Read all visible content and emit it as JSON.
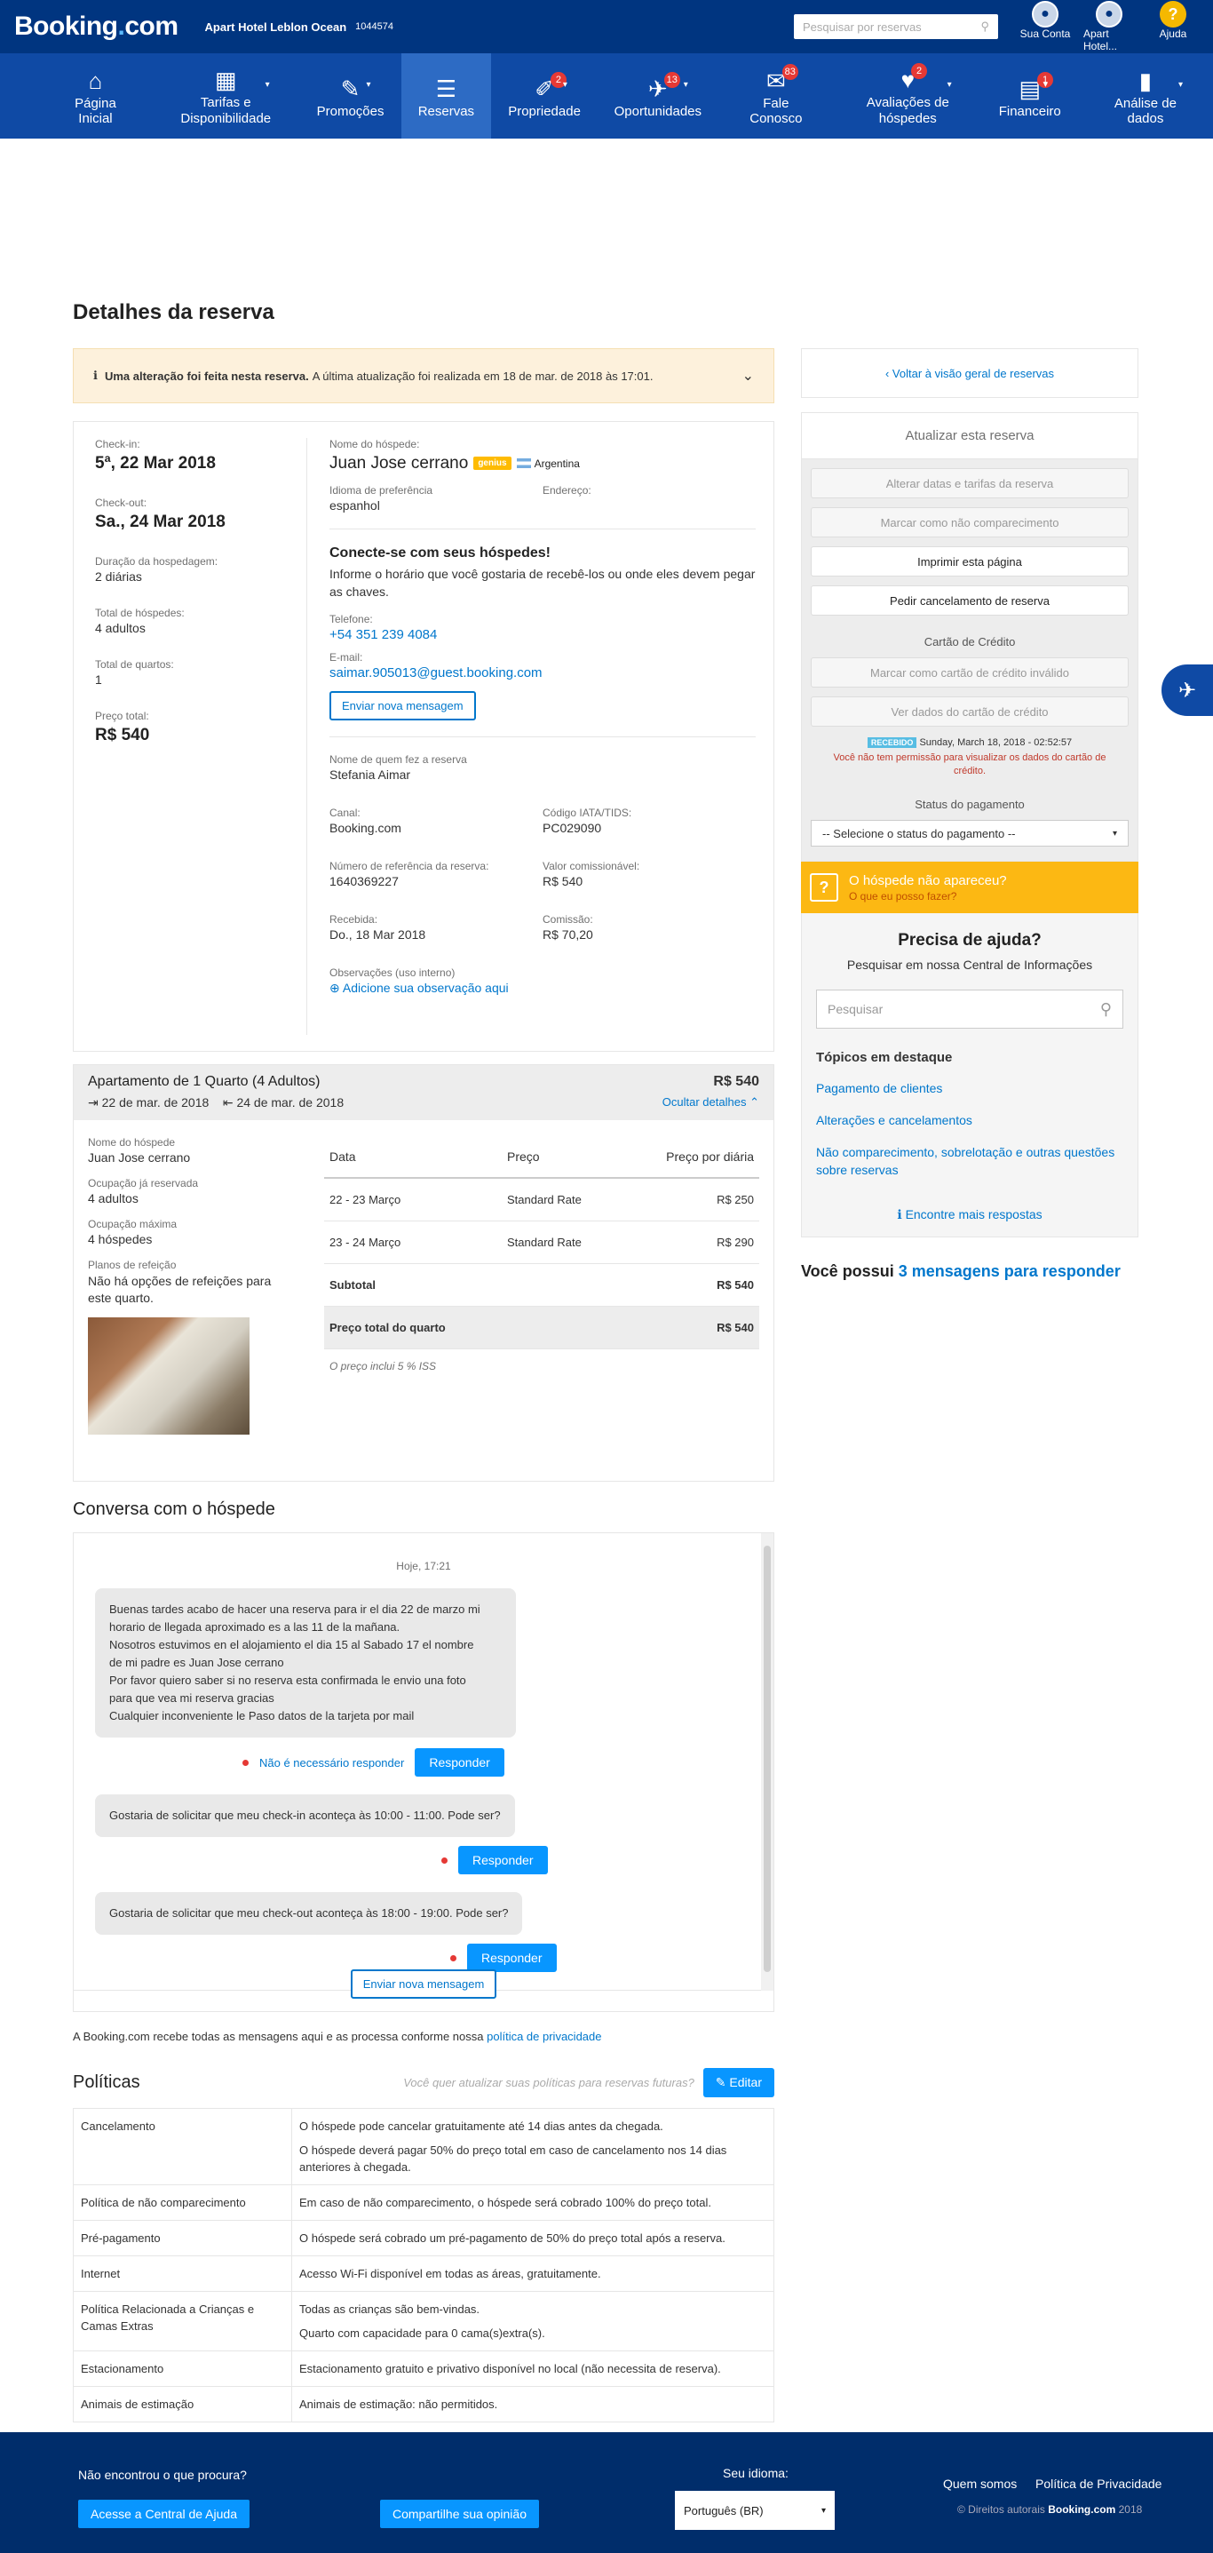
{
  "topbar": {
    "logo_main": "Booking",
    "logo_dot": ".",
    "logo_tld": "com",
    "hotel_name": "Apart Hotel Leblon Ocean",
    "hotel_id": "1044574",
    "search_placeholder": "Pesquisar por reservas",
    "account_label": "Sua Conta",
    "hotel_label": "Apart Hotel...",
    "help_label": "Ajuda",
    "help_glyph": "?"
  },
  "nav": {
    "items": [
      {
        "label": "Página Inicial",
        "icon": "home-icon",
        "glyph": "⌂",
        "badge": ""
      },
      {
        "label": "Tarifas e Disponibilidade",
        "icon": "calendar-icon",
        "glyph": "▦",
        "badge": ""
      },
      {
        "label": "Promoções",
        "icon": "tag-icon",
        "glyph": "✎",
        "badge": ""
      },
      {
        "label": "Reservas",
        "icon": "list-icon",
        "glyph": "☰",
        "badge": ""
      },
      {
        "label": "Propriedade",
        "icon": "pencil-icon",
        "glyph": "✐",
        "badge": "2"
      },
      {
        "label": "Oportunidades",
        "icon": "rocket-icon",
        "glyph": "✈",
        "badge": "13"
      },
      {
        "label": "Fale Conosco",
        "icon": "mail-icon",
        "glyph": "✉",
        "badge": "83"
      },
      {
        "label": "Avaliações de hóspedes",
        "icon": "heart-icon",
        "glyph": "♥",
        "badge": "2"
      },
      {
        "label": "Financeiro",
        "icon": "document-icon",
        "glyph": "▤",
        "badge": "1"
      },
      {
        "label": "Análise de dados",
        "icon": "chart-icon",
        "glyph": "▮",
        "badge": ""
      }
    ],
    "caret": "▾"
  },
  "page": {
    "title": "Detalhes da reserva"
  },
  "alert": {
    "icon": "info-icon",
    "glyph": "ℹ",
    "bold": "Uma alteração foi feita nesta reserva.",
    "text": "A última atualização foi realizada em 18 de mar. de 2018 às 17:01.",
    "chevron": "⌄"
  },
  "booking": {
    "checkin_label": "Check-in:",
    "checkin": "5ª, 22 Mar 2018",
    "checkout_label": "Check-out:",
    "checkout": "Sa., 24 Mar 2018",
    "duration_label": "Duração da hospedagem:",
    "duration": "2 diárias",
    "guests_label": "Total de hóspedes:",
    "guests": "4 adultos",
    "rooms_label": "Total de quartos:",
    "rooms": "1",
    "price_label": "Preço total:",
    "price": "R$ 540",
    "guest_label": "Nome do hóspede:",
    "guest_name": "Juan Jose cerrano",
    "genius": "genius",
    "country": "Argentina",
    "lang_label": "Idioma de preferência",
    "lang": "espanhol",
    "address_label": "Endereço:",
    "connect_title": "Conecte-se com seus hóspedes!",
    "connect_text": "Informe o horário que você gostaria de recebê-los ou onde eles devem pegar as chaves.",
    "phone_label": "Telefone:",
    "phone": "+54 351 239 4084",
    "email_label": "E-mail:",
    "email": "saimar.905013@guest.booking.com",
    "send_msg": "Enviar nova mensagem",
    "booker_label": "Nome de quem fez a reserva",
    "booker": "Stefania Aimar",
    "channel_label": "Canal:",
    "channel": "Booking.com",
    "iata_label": "Código IATA/TIDS:",
    "iata": "PC029090",
    "ref_label": "Número de referência da reserva:",
    "ref": "1640369227",
    "comm_value_label": "Valor comissionável:",
    "comm_value": "R$ 540",
    "received_label": "Recebida:",
    "received": "Do., 18 Mar 2018",
    "commission_label": "Comissão:",
    "commission": "R$ 70,20",
    "notes_label": "Observações (uso interno)",
    "add_note": "Adicione sua observação aqui",
    "add_glyph": "⊕"
  },
  "room": {
    "title": "Apartamento de 1 Quarto (4 Adultos)",
    "checkin": "22 de mar. de 2018",
    "checkout": "24 de mar. de 2018",
    "in_glyph": "⇥",
    "out_glyph": "⇤",
    "price": "R$ 540",
    "hide": "Ocultar detalhes",
    "hide_glyph": "⌃",
    "guest_label": "Nome do hóspede",
    "guest": "Juan Jose cerrano",
    "occ_label": "Ocupação já reservada",
    "occ": "4 adultos",
    "max_label": "Ocupação máxima",
    "max": "4 hóspedes",
    "meal_label": "Planos de refeição",
    "meal": "Não há opções de refeições para este quarto.",
    "table_head": {
      "date": "Data",
      "price": "Preço",
      "per_night": "Preço por diária"
    },
    "rows": [
      {
        "date": "22 - 23 Março",
        "price": "Standard Rate",
        "value": "R$ 250"
      },
      {
        "date": "23 - 24 Março",
        "price": "Standard Rate",
        "value": "R$ 290"
      }
    ],
    "subtotal_label": "Subtotal",
    "subtotal": "R$ 540",
    "total_label": "Preço total do quarto",
    "total": "R$ 540",
    "tax_note": "O preço inclui 5 % ISS"
  },
  "conversation": {
    "title": "Conversa com o hóspede",
    "date": "Hoje, 17:21",
    "msg1": "Buenas tardes acabo de hacer una reserva para ir el dia 22 de marzo mi\nhorario de llegada aproximado es a las 11 de la mañana.\nNosotros estuvimos en el alojamiento el dia 15 al Sabado 17 el nombre\nde mi padre es Juan Jose cerrano\nPor favor quiero saber si no reserva esta confirmada le envio una foto\npara que vea mi reserva gracias\nCualquier inconveniente le Paso datos de la tarjeta por mail",
    "no_reply": "Não é necessário responder",
    "reply": "Responder",
    "msg2": "Gostaria de solicitar que meu check-in aconteça às 10:00 - 11:00. Pode ser?",
    "msg3": "Gostaria de solicitar que meu check-out aconteça às 18:00 - 19:00. Pode ser?",
    "send": "Enviar nova mensagem"
  },
  "privacy": {
    "text": "A Booking.com recebe todas as mensagens aqui e as processa conforme nossa",
    "link": "política de privacidade"
  },
  "policies": {
    "title": "Políticas",
    "question": "Você quer atualizar suas políticas para reservas futuras?",
    "edit": "Editar",
    "edit_glyph": "✎",
    "rows": [
      {
        "k": "Cancelamento",
        "v": [
          "O hóspede pode cancelar gratuitamente até 14 dias antes da chegada.",
          "O hóspede deverá pagar 50% do preço total em caso de cancelamento nos 14 dias anteriores à chegada."
        ]
      },
      {
        "k": "Política de não comparecimento",
        "v": [
          "Em caso de não comparecimento, o hóspede será cobrado 100% do preço total."
        ]
      },
      {
        "k": "Pré-pagamento",
        "v": [
          "O hóspede será cobrado um pré-pagamento de 50% do preço total após a reserva."
        ]
      },
      {
        "k": "Internet",
        "v": [
          "Acesso Wi-Fi disponível em todas as áreas, gratuitamente."
        ]
      },
      {
        "k": "Política Relacionada a Crianças e Camas Extras",
        "v": [
          "Todas as crianças são bem-vindas.",
          "Quarto com capacidade para 0 cama(s)extra(s)."
        ]
      },
      {
        "k": "Estacionamento",
        "v": [
          "Estacionamento gratuito e privativo disponível no local (não necessita de reserva)."
        ]
      },
      {
        "k": "Animais de estimação",
        "v": [
          "Animais de estimação: não permitidos."
        ]
      }
    ]
  },
  "sidebar": {
    "back": "Voltar à visão geral de reservas",
    "back_glyph": "‹",
    "update_title": "Atualizar esta reserva",
    "btn_dates": "Alterar datas e tarifas da reserva",
    "btn_noshow": "Marcar como não comparecimento",
    "btn_print": "Imprimir esta página",
    "btn_cancel": "Pedir cancelamento de reserva",
    "card_title": "Cartão de Crédito",
    "btn_invalid": "Marcar como cartão de crédito inválido",
    "btn_view_card": "Ver dados do cartão de crédito",
    "received_badge": "RECEBIDO",
    "received_time": "Sunday, March 18, 2018 - 02:52:57",
    "no_perm": "Você não tem permissão para visualizar os dados do cartão de crédito.",
    "pay_title": "Status do pagamento",
    "pay_select": "-- Selecione o status do pagamento --",
    "arrow": "▾",
    "noshow_title": "O hóspede não apareceu?",
    "noshow_link": "O que eu posso fazer?",
    "noshow_glyph": "?",
    "help_title": "Precisa de ajuda?",
    "help_sub": "Pesquisar em nossa Central de Informações",
    "help_placeholder": "Pesquisar",
    "search_glyph": "⚲",
    "topics_title": "Tópicos em destaque",
    "topics": [
      "Pagamento de clientes",
      "Alterações e cancelamentos",
      "Não comparecimento, sobrelotação e outras questões sobre reservas"
    ],
    "more": "Encontre mais respostas",
    "more_glyph": "ℹ",
    "msgs_prefix": "Você possui",
    "msgs_link": "3 mensagens para responder"
  },
  "rocket_glyph": "✈",
  "footer": {
    "question": "Não encontrou o que procura?",
    "help_btn": "Acesse a Central de Ajuda",
    "share_btn": "Compartilhe sua opinião",
    "lang_label": "Seu idioma:",
    "lang": "Português (BR)",
    "about": "Quem somos",
    "privacy": "Política de Privacidade",
    "copy_pre": "© Direitos autorais",
    "copy_brand": "Booking.com",
    "copy_year": "2018"
  }
}
